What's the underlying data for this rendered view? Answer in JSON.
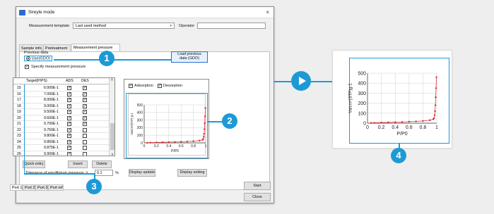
{
  "window": {
    "title": "Sireyle mode",
    "close": "×"
  },
  "header": {
    "template_label": "Measurement template",
    "template_value": "Last used method",
    "operator_label": "Operator",
    "operator_value": ""
  },
  "tabs": [
    {
      "label": "Sample info."
    },
    {
      "label": "Pretreatment"
    },
    {
      "label": "Measurement pressure"
    }
  ],
  "previous": {
    "label": "Previous data",
    "radio_label": "Use(GDO)",
    "load_button": [
      "Load previous",
      "data (GDO)"
    ]
  },
  "specify_label": "Specify measurement pressure",
  "table": {
    "headers": [
      "Target(P/PS)",
      "ADS",
      "DES"
    ],
    "rows": [
      {
        "no": "15",
        "target": "6.000E-1",
        "ads": true,
        "des": true
      },
      {
        "no": "16",
        "target": "7.000E-1",
        "ads": true,
        "des": true
      },
      {
        "no": "17",
        "target": "8.000E-1",
        "ads": true,
        "des": true
      },
      {
        "no": "18",
        "target": "9.000E-1",
        "ads": true,
        "des": true
      },
      {
        "no": "19",
        "target": "9.500E-1",
        "ads": true,
        "des": true
      },
      {
        "no": "20",
        "target": "9.600E-1",
        "ads": true,
        "des": true
      },
      {
        "no": "21",
        "target": "9.700E-1",
        "ads": true,
        "des": true
      },
      {
        "no": "22",
        "target": "9.750E-1",
        "ads": true,
        "des": false
      },
      {
        "no": "23",
        "target": "9.800E-1",
        "ads": true,
        "des": false
      },
      {
        "no": "24",
        "target": "9.850E-1",
        "ads": true,
        "des": false
      },
      {
        "no": "25",
        "target": "9.875E-1",
        "ads": true,
        "des": false
      },
      {
        "no": "26",
        "target": "9.900E-1",
        "ads": true,
        "des": false
      }
    ]
  },
  "buttons": {
    "quick_entry": "Quick entry",
    "insert": "Insert",
    "delete": "Delete",
    "display_update": "Display update",
    "display_setting": "Display setting",
    "start": "Start",
    "close": "Close"
  },
  "tolerance": {
    "label": "Tolerance of equilibrium pressure: ±",
    "value": "0.1",
    "unit": "%"
  },
  "chart_options": {
    "adsorption": "Adsorption",
    "desorption": "Desorption"
  },
  "ports": [
    "Port 1",
    "Port 2",
    "Port 3",
    "Port ref"
  ],
  "callouts": [
    "1",
    "2",
    "3",
    "4"
  ],
  "colors": {
    "accent": "#1d9ad6",
    "series": "#e0232b"
  },
  "chart_data": [
    {
      "type": "scatter",
      "title": "",
      "xlabel": "P/P0",
      "ylabel": "Va/cm³(STP) g-1",
      "xlim": [
        0,
        1
      ],
      "ylim": [
        0,
        500
      ],
      "xticks": [
        "0",
        "0.2",
        "0.4",
        "0.6",
        "0.8",
        "1"
      ],
      "yticks": [
        "0",
        "100",
        "200",
        "300",
        "400",
        "500"
      ],
      "grid": true,
      "series": [
        {
          "x": [
            0.05,
            0.1,
            0.2,
            0.3,
            0.4,
            0.5,
            0.6,
            0.7,
            0.8,
            0.9,
            0.95,
            0.96,
            0.97,
            0.975,
            0.98,
            0.985,
            0.99,
            0.995
          ],
          "values": [
            2,
            4,
            6,
            8,
            10,
            12,
            15,
            18,
            22,
            30,
            40,
            50,
            80,
            120,
            180,
            260,
            350,
            460
          ]
        }
      ]
    },
    {
      "type": "scatter",
      "title": "",
      "xlabel": "P/P0",
      "ylabel": "Va/cm³(STP)g-1",
      "xlim": [
        0,
        1
      ],
      "ylim": [
        0,
        500
      ],
      "xticks": [
        "0",
        "0.2",
        "0.4",
        "0.6",
        "0.8",
        "1"
      ],
      "yticks": [
        "0",
        "100",
        "200",
        "300",
        "400",
        "500"
      ],
      "grid": true,
      "series": [
        {
          "x": [
            0.05,
            0.1,
            0.2,
            0.3,
            0.4,
            0.5,
            0.6,
            0.7,
            0.8,
            0.9,
            0.95,
            0.96,
            0.97,
            0.975,
            0.98,
            0.985,
            0.99,
            0.995
          ],
          "values": [
            2,
            4,
            6,
            8,
            10,
            12,
            15,
            18,
            22,
            30,
            40,
            50,
            80,
            120,
            180,
            260,
            350,
            460
          ]
        }
      ]
    }
  ]
}
